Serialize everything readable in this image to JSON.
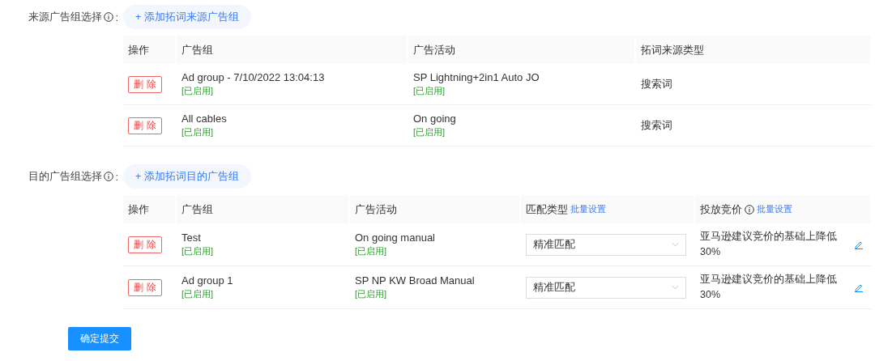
{
  "source": {
    "label": "来源广告组选择",
    "info_icon": true,
    "colon": ":",
    "add_button": "+ 添加拓词来源广告组",
    "columns": [
      "操作",
      "广告组",
      "广告活动",
      "拓词来源类型"
    ],
    "rows": [
      {
        "action": "删 除",
        "ad_group": "Ad group - 7/10/2022 13:04:13",
        "ad_group_status": "[已启用]",
        "campaign": "SP Lightning+2in1 Auto JO",
        "campaign_status": "[已启用]",
        "source_type": "搜索词"
      },
      {
        "action": "删 除",
        "ad_group": "All cables",
        "ad_group_status": "[已启用]",
        "campaign": "On going",
        "campaign_status": "[已启用]",
        "source_type": "搜索词"
      }
    ]
  },
  "target": {
    "label": "目的广告组选择",
    "info_icon": true,
    "colon": ":",
    "add_button": "+ 添加拓词目的广告组",
    "columns": [
      {
        "title": "操作"
      },
      {
        "title": "广告组"
      },
      {
        "title": "广告活动"
      },
      {
        "title": "匹配类型",
        "link": "批量设置"
      },
      {
        "title": "投放竞价",
        "info_icon": true,
        "link": "批量设置"
      }
    ],
    "rows": [
      {
        "action": "删 除",
        "ad_group": "Test",
        "ad_group_status": "[已启用]",
        "campaign": "On going manual",
        "campaign_status": "[已启用]",
        "match_type": "精准匹配",
        "bid": "亚马逊建议竞价的基础上降低30%"
      },
      {
        "action": "删 除",
        "ad_group": "Ad group 1",
        "ad_group_status": "[已启用]",
        "campaign": "SP NP KW Broad Manual",
        "campaign_status": "[已启用]",
        "match_type": "精准匹配",
        "bid": "亚马逊建议竞价的基础上降低30%"
      }
    ]
  },
  "submit_button": "确定提交"
}
